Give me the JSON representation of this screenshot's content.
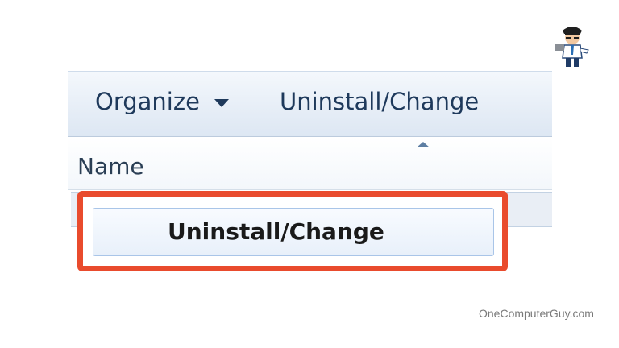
{
  "toolbar": {
    "organize_label": "Organize",
    "uninstall_change_label": "Uninstall/Change"
  },
  "column_header": {
    "name_label": "Name"
  },
  "highlighted_item": {
    "label": "Uninstall/Change",
    "highlight_color": "#e94b2d"
  },
  "watermark": "OneComputerGuy.com",
  "colors": {
    "toolbar_text": "#1e395b",
    "toolbar_bg": "#e7eef7"
  }
}
